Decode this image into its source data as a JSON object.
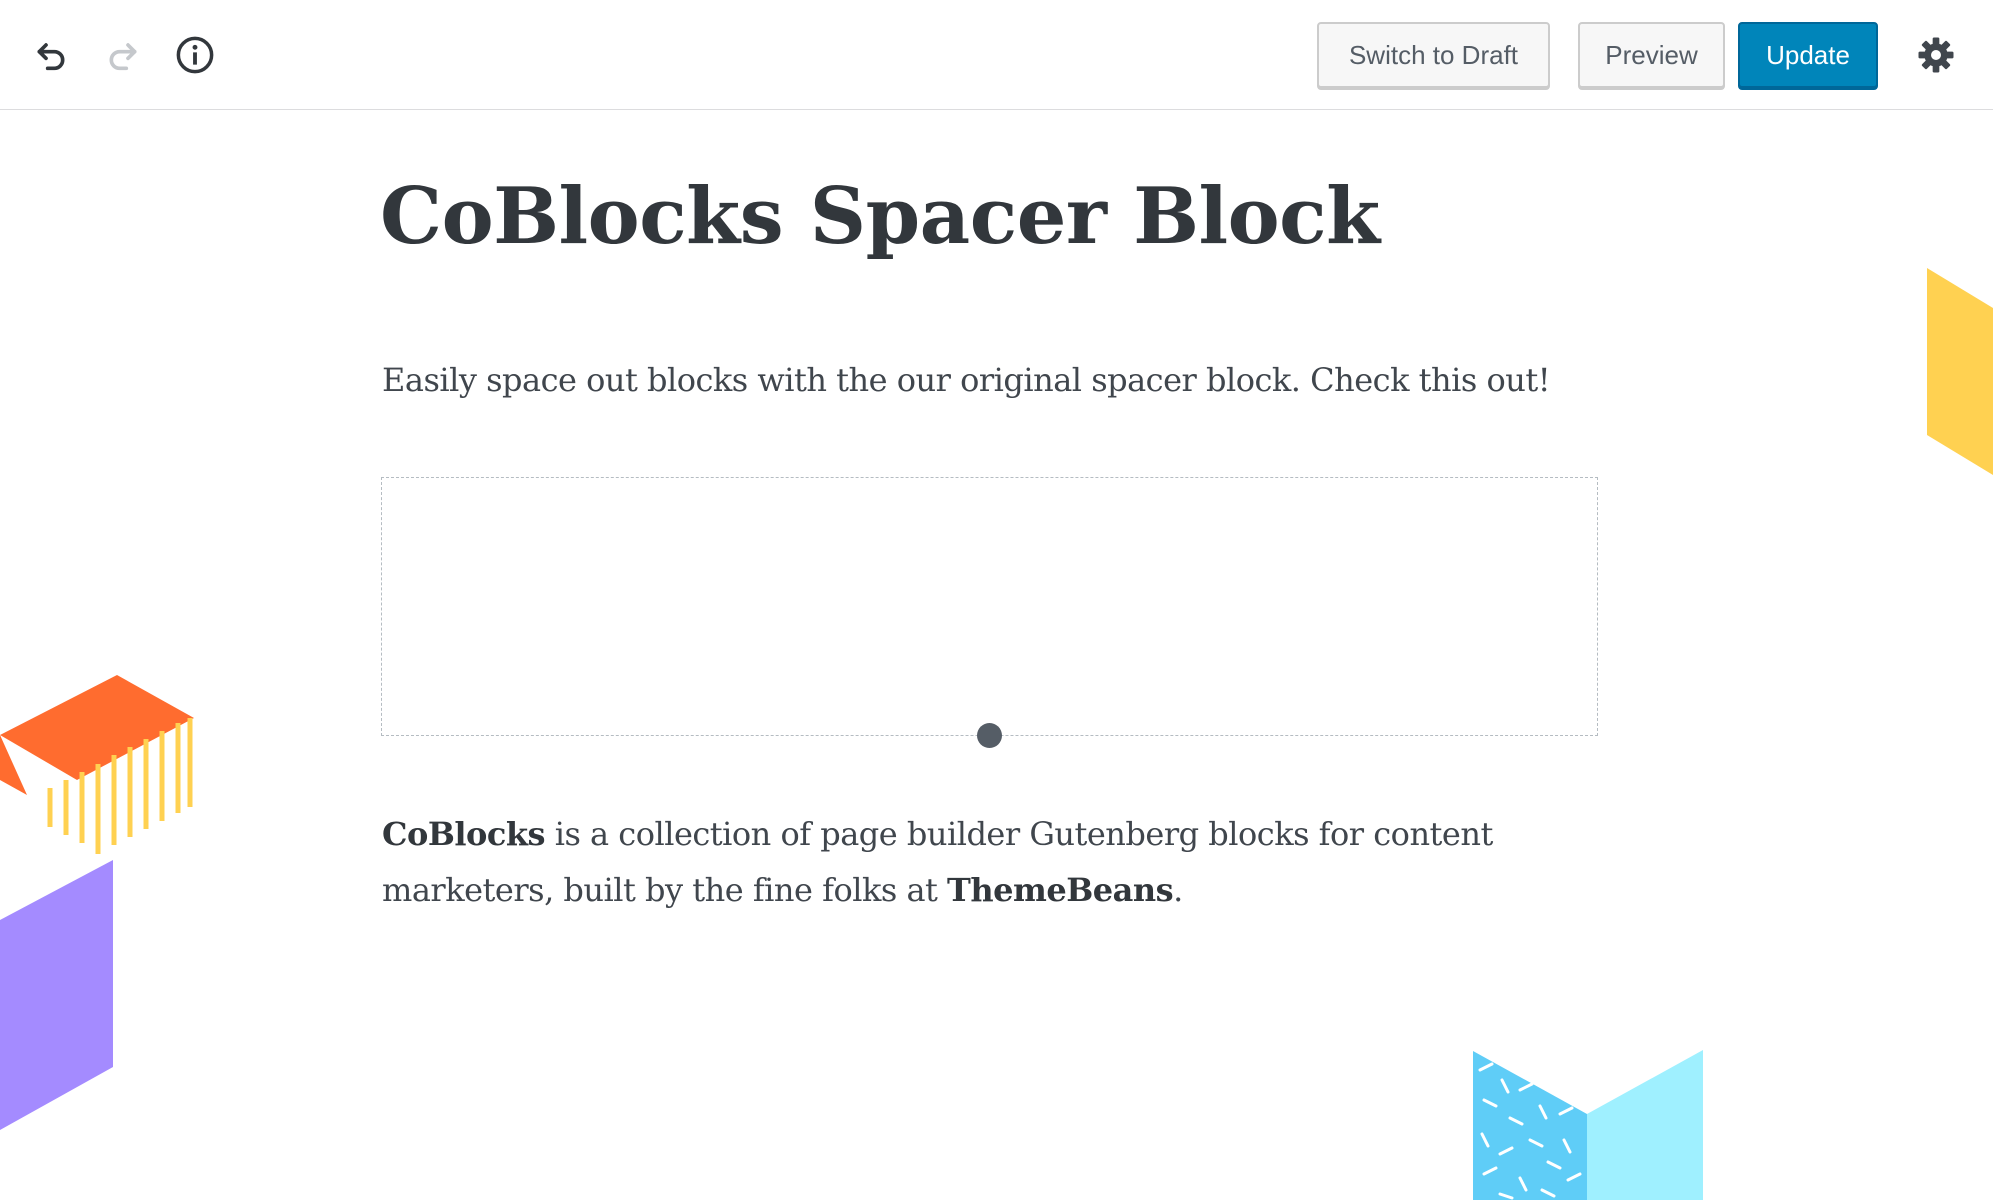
{
  "toolbar": {
    "undo_icon": "undo-icon",
    "redo_icon": "redo-icon",
    "info_icon": "info-icon",
    "settings_icon": "gear-icon",
    "switch_to_draft_label": "Switch to Draft",
    "preview_label": "Preview",
    "update_label": "Update",
    "primary_color": "#0085ba"
  },
  "post": {
    "title": "CoBlocks Spacer Block",
    "intro": "Easily space out blocks with the our original spacer block. Check this out!",
    "body_brand": "CoBlocks",
    "body_mid": " is a collection of page builder Gutenberg blocks for content marketers, built by the fine folks at ",
    "body_author": "ThemeBeans",
    "body_end": "."
  },
  "decorations": {
    "yellow": "#ffd151",
    "orange": "#ff6c2f",
    "purple": "#a48bff",
    "light_blue": "#9ff0ff",
    "blue_pattern": "#5fcdf7"
  }
}
